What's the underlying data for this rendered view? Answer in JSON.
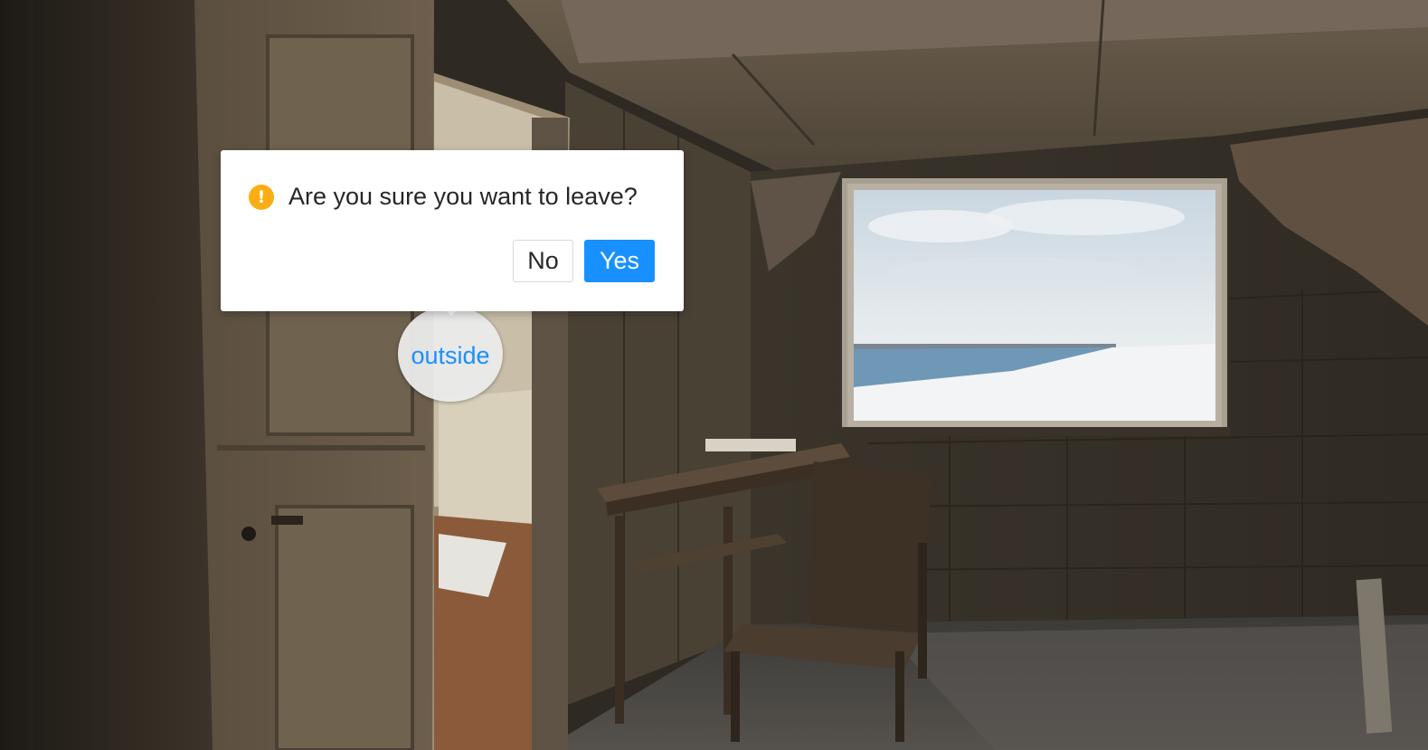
{
  "hotspot": {
    "label": "outside"
  },
  "popconfirm": {
    "icon": "exclamation-circle-icon",
    "icon_glyph": "!",
    "title": "Are you sure you want to leave?",
    "cancel_label": "No",
    "ok_label": "Yes"
  },
  "colors": {
    "primary": "#1890ff",
    "warning": "#faad14"
  }
}
